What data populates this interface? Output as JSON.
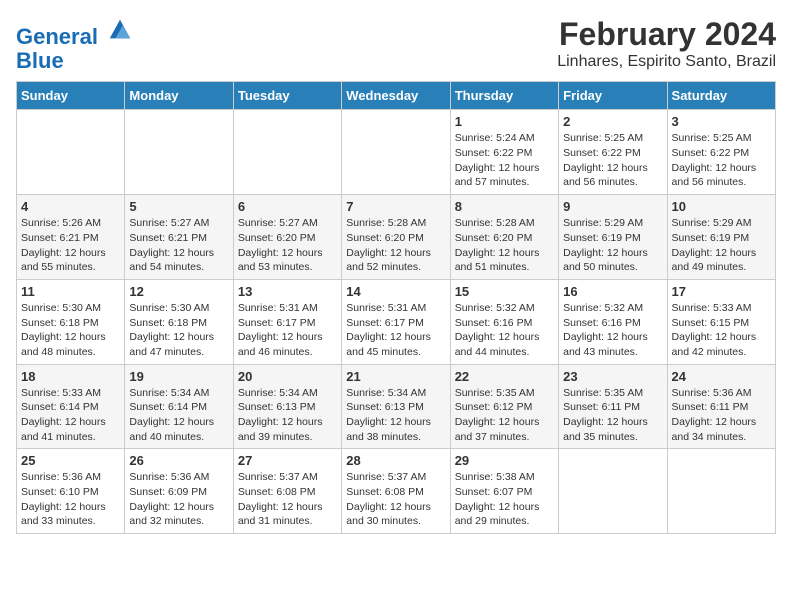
{
  "header": {
    "logo_line1": "General",
    "logo_line2": "Blue",
    "title": "February 2024",
    "subtitle": "Linhares, Espirito Santo, Brazil"
  },
  "days_of_week": [
    "Sunday",
    "Monday",
    "Tuesday",
    "Wednesday",
    "Thursday",
    "Friday",
    "Saturday"
  ],
  "weeks": [
    [
      {
        "num": "",
        "info": ""
      },
      {
        "num": "",
        "info": ""
      },
      {
        "num": "",
        "info": ""
      },
      {
        "num": "",
        "info": ""
      },
      {
        "num": "1",
        "info": "Sunrise: 5:24 AM\nSunset: 6:22 PM\nDaylight: 12 hours\nand 57 minutes."
      },
      {
        "num": "2",
        "info": "Sunrise: 5:25 AM\nSunset: 6:22 PM\nDaylight: 12 hours\nand 56 minutes."
      },
      {
        "num": "3",
        "info": "Sunrise: 5:25 AM\nSunset: 6:22 PM\nDaylight: 12 hours\nand 56 minutes."
      }
    ],
    [
      {
        "num": "4",
        "info": "Sunrise: 5:26 AM\nSunset: 6:21 PM\nDaylight: 12 hours\nand 55 minutes."
      },
      {
        "num": "5",
        "info": "Sunrise: 5:27 AM\nSunset: 6:21 PM\nDaylight: 12 hours\nand 54 minutes."
      },
      {
        "num": "6",
        "info": "Sunrise: 5:27 AM\nSunset: 6:20 PM\nDaylight: 12 hours\nand 53 minutes."
      },
      {
        "num": "7",
        "info": "Sunrise: 5:28 AM\nSunset: 6:20 PM\nDaylight: 12 hours\nand 52 minutes."
      },
      {
        "num": "8",
        "info": "Sunrise: 5:28 AM\nSunset: 6:20 PM\nDaylight: 12 hours\nand 51 minutes."
      },
      {
        "num": "9",
        "info": "Sunrise: 5:29 AM\nSunset: 6:19 PM\nDaylight: 12 hours\nand 50 minutes."
      },
      {
        "num": "10",
        "info": "Sunrise: 5:29 AM\nSunset: 6:19 PM\nDaylight: 12 hours\nand 49 minutes."
      }
    ],
    [
      {
        "num": "11",
        "info": "Sunrise: 5:30 AM\nSunset: 6:18 PM\nDaylight: 12 hours\nand 48 minutes."
      },
      {
        "num": "12",
        "info": "Sunrise: 5:30 AM\nSunset: 6:18 PM\nDaylight: 12 hours\nand 47 minutes."
      },
      {
        "num": "13",
        "info": "Sunrise: 5:31 AM\nSunset: 6:17 PM\nDaylight: 12 hours\nand 46 minutes."
      },
      {
        "num": "14",
        "info": "Sunrise: 5:31 AM\nSunset: 6:17 PM\nDaylight: 12 hours\nand 45 minutes."
      },
      {
        "num": "15",
        "info": "Sunrise: 5:32 AM\nSunset: 6:16 PM\nDaylight: 12 hours\nand 44 minutes."
      },
      {
        "num": "16",
        "info": "Sunrise: 5:32 AM\nSunset: 6:16 PM\nDaylight: 12 hours\nand 43 minutes."
      },
      {
        "num": "17",
        "info": "Sunrise: 5:33 AM\nSunset: 6:15 PM\nDaylight: 12 hours\nand 42 minutes."
      }
    ],
    [
      {
        "num": "18",
        "info": "Sunrise: 5:33 AM\nSunset: 6:14 PM\nDaylight: 12 hours\nand 41 minutes."
      },
      {
        "num": "19",
        "info": "Sunrise: 5:34 AM\nSunset: 6:14 PM\nDaylight: 12 hours\nand 40 minutes."
      },
      {
        "num": "20",
        "info": "Sunrise: 5:34 AM\nSunset: 6:13 PM\nDaylight: 12 hours\nand 39 minutes."
      },
      {
        "num": "21",
        "info": "Sunrise: 5:34 AM\nSunset: 6:13 PM\nDaylight: 12 hours\nand 38 minutes."
      },
      {
        "num": "22",
        "info": "Sunrise: 5:35 AM\nSunset: 6:12 PM\nDaylight: 12 hours\nand 37 minutes."
      },
      {
        "num": "23",
        "info": "Sunrise: 5:35 AM\nSunset: 6:11 PM\nDaylight: 12 hours\nand 35 minutes."
      },
      {
        "num": "24",
        "info": "Sunrise: 5:36 AM\nSunset: 6:11 PM\nDaylight: 12 hours\nand 34 minutes."
      }
    ],
    [
      {
        "num": "25",
        "info": "Sunrise: 5:36 AM\nSunset: 6:10 PM\nDaylight: 12 hours\nand 33 minutes."
      },
      {
        "num": "26",
        "info": "Sunrise: 5:36 AM\nSunset: 6:09 PM\nDaylight: 12 hours\nand 32 minutes."
      },
      {
        "num": "27",
        "info": "Sunrise: 5:37 AM\nSunset: 6:08 PM\nDaylight: 12 hours\nand 31 minutes."
      },
      {
        "num": "28",
        "info": "Sunrise: 5:37 AM\nSunset: 6:08 PM\nDaylight: 12 hours\nand 30 minutes."
      },
      {
        "num": "29",
        "info": "Sunrise: 5:38 AM\nSunset: 6:07 PM\nDaylight: 12 hours\nand 29 minutes."
      },
      {
        "num": "",
        "info": ""
      },
      {
        "num": "",
        "info": ""
      }
    ]
  ]
}
